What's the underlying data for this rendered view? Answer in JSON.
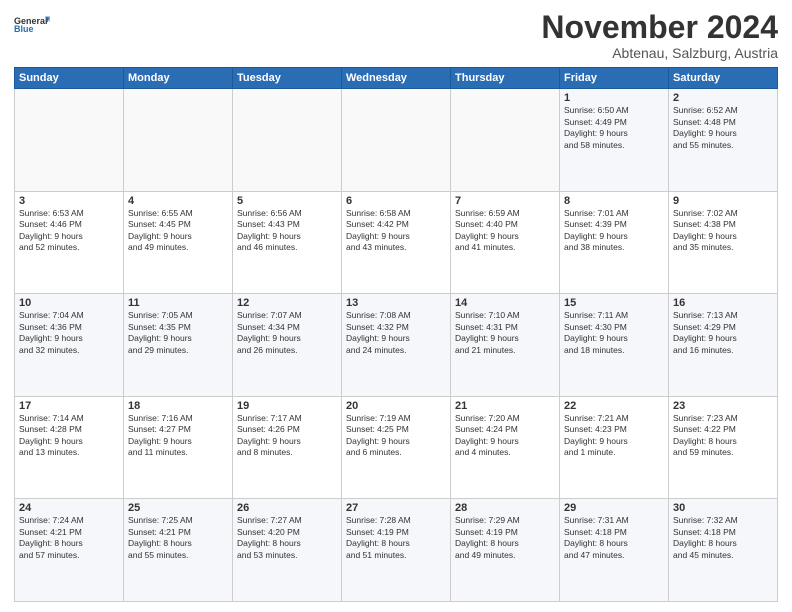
{
  "header": {
    "logo_line1": "General",
    "logo_line2": "Blue",
    "month": "November 2024",
    "location": "Abtenau, Salzburg, Austria"
  },
  "weekdays": [
    "Sunday",
    "Monday",
    "Tuesday",
    "Wednesday",
    "Thursday",
    "Friday",
    "Saturday"
  ],
  "weeks": [
    [
      {
        "day": "",
        "info": ""
      },
      {
        "day": "",
        "info": ""
      },
      {
        "day": "",
        "info": ""
      },
      {
        "day": "",
        "info": ""
      },
      {
        "day": "",
        "info": ""
      },
      {
        "day": "1",
        "info": "Sunrise: 6:50 AM\nSunset: 4:49 PM\nDaylight: 9 hours\nand 58 minutes."
      },
      {
        "day": "2",
        "info": "Sunrise: 6:52 AM\nSunset: 4:48 PM\nDaylight: 9 hours\nand 55 minutes."
      }
    ],
    [
      {
        "day": "3",
        "info": "Sunrise: 6:53 AM\nSunset: 4:46 PM\nDaylight: 9 hours\nand 52 minutes."
      },
      {
        "day": "4",
        "info": "Sunrise: 6:55 AM\nSunset: 4:45 PM\nDaylight: 9 hours\nand 49 minutes."
      },
      {
        "day": "5",
        "info": "Sunrise: 6:56 AM\nSunset: 4:43 PM\nDaylight: 9 hours\nand 46 minutes."
      },
      {
        "day": "6",
        "info": "Sunrise: 6:58 AM\nSunset: 4:42 PM\nDaylight: 9 hours\nand 43 minutes."
      },
      {
        "day": "7",
        "info": "Sunrise: 6:59 AM\nSunset: 4:40 PM\nDaylight: 9 hours\nand 41 minutes."
      },
      {
        "day": "8",
        "info": "Sunrise: 7:01 AM\nSunset: 4:39 PM\nDaylight: 9 hours\nand 38 minutes."
      },
      {
        "day": "9",
        "info": "Sunrise: 7:02 AM\nSunset: 4:38 PM\nDaylight: 9 hours\nand 35 minutes."
      }
    ],
    [
      {
        "day": "10",
        "info": "Sunrise: 7:04 AM\nSunset: 4:36 PM\nDaylight: 9 hours\nand 32 minutes."
      },
      {
        "day": "11",
        "info": "Sunrise: 7:05 AM\nSunset: 4:35 PM\nDaylight: 9 hours\nand 29 minutes."
      },
      {
        "day": "12",
        "info": "Sunrise: 7:07 AM\nSunset: 4:34 PM\nDaylight: 9 hours\nand 26 minutes."
      },
      {
        "day": "13",
        "info": "Sunrise: 7:08 AM\nSunset: 4:32 PM\nDaylight: 9 hours\nand 24 minutes."
      },
      {
        "day": "14",
        "info": "Sunrise: 7:10 AM\nSunset: 4:31 PM\nDaylight: 9 hours\nand 21 minutes."
      },
      {
        "day": "15",
        "info": "Sunrise: 7:11 AM\nSunset: 4:30 PM\nDaylight: 9 hours\nand 18 minutes."
      },
      {
        "day": "16",
        "info": "Sunrise: 7:13 AM\nSunset: 4:29 PM\nDaylight: 9 hours\nand 16 minutes."
      }
    ],
    [
      {
        "day": "17",
        "info": "Sunrise: 7:14 AM\nSunset: 4:28 PM\nDaylight: 9 hours\nand 13 minutes."
      },
      {
        "day": "18",
        "info": "Sunrise: 7:16 AM\nSunset: 4:27 PM\nDaylight: 9 hours\nand 11 minutes."
      },
      {
        "day": "19",
        "info": "Sunrise: 7:17 AM\nSunset: 4:26 PM\nDaylight: 9 hours\nand 8 minutes."
      },
      {
        "day": "20",
        "info": "Sunrise: 7:19 AM\nSunset: 4:25 PM\nDaylight: 9 hours\nand 6 minutes."
      },
      {
        "day": "21",
        "info": "Sunrise: 7:20 AM\nSunset: 4:24 PM\nDaylight: 9 hours\nand 4 minutes."
      },
      {
        "day": "22",
        "info": "Sunrise: 7:21 AM\nSunset: 4:23 PM\nDaylight: 9 hours\nand 1 minute."
      },
      {
        "day": "23",
        "info": "Sunrise: 7:23 AM\nSunset: 4:22 PM\nDaylight: 8 hours\nand 59 minutes."
      }
    ],
    [
      {
        "day": "24",
        "info": "Sunrise: 7:24 AM\nSunset: 4:21 PM\nDaylight: 8 hours\nand 57 minutes."
      },
      {
        "day": "25",
        "info": "Sunrise: 7:25 AM\nSunset: 4:21 PM\nDaylight: 8 hours\nand 55 minutes."
      },
      {
        "day": "26",
        "info": "Sunrise: 7:27 AM\nSunset: 4:20 PM\nDaylight: 8 hours\nand 53 minutes."
      },
      {
        "day": "27",
        "info": "Sunrise: 7:28 AM\nSunset: 4:19 PM\nDaylight: 8 hours\nand 51 minutes."
      },
      {
        "day": "28",
        "info": "Sunrise: 7:29 AM\nSunset: 4:19 PM\nDaylight: 8 hours\nand 49 minutes."
      },
      {
        "day": "29",
        "info": "Sunrise: 7:31 AM\nSunset: 4:18 PM\nDaylight: 8 hours\nand 47 minutes."
      },
      {
        "day": "30",
        "info": "Sunrise: 7:32 AM\nSunset: 4:18 PM\nDaylight: 8 hours\nand 45 minutes."
      }
    ]
  ]
}
